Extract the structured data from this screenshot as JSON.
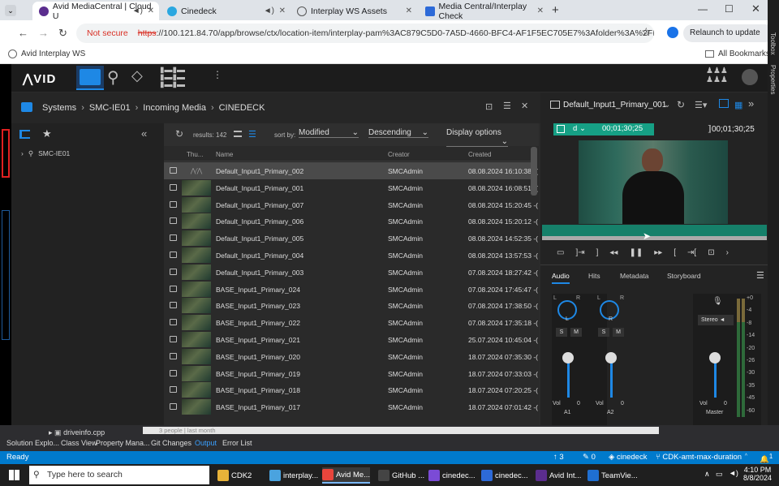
{
  "browser": {
    "tabs": [
      {
        "label": "Avid MediaCentral | Cloud U",
        "active": true
      },
      {
        "label": "Cinedeck"
      },
      {
        "label": "Interplay WS Assets"
      },
      {
        "label": "Media Central/Interplay Check"
      }
    ],
    "security": "Not secure",
    "url_scheme": "https",
    "url_rest": "://100.121.84.70/app/browse/ctx/location-item/interplay-pam%3AC879C5D0-7A5D-4660-BFC4-AF1F5EC705E7%3Afolder%3A%2FIncoming%20...",
    "relaunch": "Relaunch to update",
    "bookmark": "Avid Interplay WS",
    "all_bookmarks": "All Bookmarks"
  },
  "breadcrumb": [
    "Systems",
    "SMC-IE01",
    "Incoming Media",
    "CINEDECK"
  ],
  "tree": {
    "root": "SMC-IE01"
  },
  "list": {
    "results": "results: 142",
    "sort_by_label": "sort by:",
    "sort_by": "Modified",
    "order": "Descending",
    "display_options": "Display options",
    "columns": {
      "thumb": "Thu...",
      "name": "Name",
      "creator": "Creator",
      "created": "Created"
    },
    "rows": [
      {
        "name": "Default_Input1_Primary_002",
        "creator": "SMCAdmin",
        "created": "08.08.2024 16:10:38 -(",
        "no_thumb": true,
        "selected": true
      },
      {
        "name": "Default_Input1_Primary_001",
        "creator": "SMCAdmin",
        "created": "08.08.2024 16:08:51 -("
      },
      {
        "name": "Default_Input1_Primary_007",
        "creator": "SMCAdmin",
        "created": "08.08.2024 15:20:45 -("
      },
      {
        "name": "Default_Input1_Primary_006",
        "creator": "SMCAdmin",
        "created": "08.08.2024 15:20:12 -("
      },
      {
        "name": "Default_Input1_Primary_005",
        "creator": "SMCAdmin",
        "created": "08.08.2024 14:52:35 -("
      },
      {
        "name": "Default_Input1_Primary_004",
        "creator": "SMCAdmin",
        "created": "08.08.2024 13:57:53 -("
      },
      {
        "name": "Default_Input1_Primary_003",
        "creator": "SMCAdmin",
        "created": "07.08.2024 18:27:42 -("
      },
      {
        "name": "BASE_Input1_Primary_024",
        "creator": "SMCAdmin",
        "created": "07.08.2024 17:45:47 -("
      },
      {
        "name": "BASE_Input1_Primary_023",
        "creator": "SMCAdmin",
        "created": "07.08.2024 17:38:50 -("
      },
      {
        "name": "BASE_Input1_Primary_022",
        "creator": "SMCAdmin",
        "created": "07.08.2024 17:35:18 -("
      },
      {
        "name": "BASE_Input1_Primary_021",
        "creator": "SMCAdmin",
        "created": "25.07.2024 10:45:04 -("
      },
      {
        "name": "BASE_Input1_Primary_020",
        "creator": "SMCAdmin",
        "created": "18.07.2024 07:35:30 -("
      },
      {
        "name": "BASE_Input1_Primary_019",
        "creator": "SMCAdmin",
        "created": "18.07.2024 07:33:03 -("
      },
      {
        "name": "BASE_Input1_Primary_018",
        "creator": "SMCAdmin",
        "created": "18.07.2024 07:20:25 -("
      },
      {
        "name": "BASE_Input1_Primary_017",
        "creator": "SMCAdmin",
        "created": "18.07.2024 07:01:42 -("
      }
    ]
  },
  "player": {
    "clip": "Default_Input1_Primary_001",
    "timecode": "00;01;30;25",
    "duration": "00;01;30;25",
    "track": "d",
    "tabs": [
      "Audio",
      "Hits",
      "Metadata",
      "Storyboard"
    ],
    "ch1": "A1",
    "ch2": "A2",
    "master": "Master",
    "vol_label": "Vol",
    "vol_value": "0",
    "L": "L",
    "R": "R",
    "S": "S",
    "M": "M",
    "stereo": "Stereo",
    "meter": [
      "+0",
      "-4",
      "-8",
      "-14",
      "-20",
      "-26",
      "-30",
      "-35",
      "-45",
      "-60"
    ]
  },
  "vs": {
    "file": "driveinfo.cpp",
    "hint": "3 people | last month",
    "tabs": [
      "Solution Explo...",
      "Class View",
      "Property Mana...",
      "Git Changes",
      "Output",
      "Error List"
    ],
    "side": [
      "Toolbox",
      "Properties"
    ],
    "status": "Ready",
    "up": "3",
    "pencil": "0",
    "repo": "cinedeck",
    "branch": "CDK-amt-max-duration",
    "bell": "1"
  },
  "taskbar": {
    "search": "Type here to search",
    "items": [
      "CDK2",
      "interplay...",
      "Avid Me...",
      "GitHub ...",
      "cinedec...",
      "cinedec...",
      "Avid Int...",
      "TeamVie..."
    ],
    "time": "4:10 PM",
    "date": "8/8/2024"
  },
  "colors": {
    "accent": "#1e88e5",
    "teal": "#16a085",
    "vsblue": "#007acc"
  }
}
